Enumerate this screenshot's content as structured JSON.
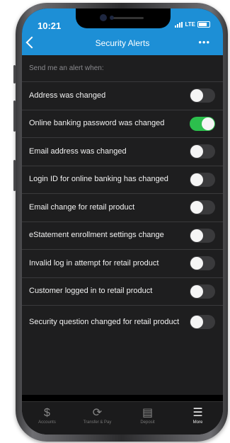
{
  "status": {
    "time": "10:21",
    "network": "LTE"
  },
  "header": {
    "title": "Security Alerts",
    "more": "•••"
  },
  "section_label": "Send me an alert when:",
  "alerts": [
    {
      "label": "Address was changed",
      "enabled": false
    },
    {
      "label": "Online banking password was changed",
      "enabled": true
    },
    {
      "label": "Email address was changed",
      "enabled": false
    },
    {
      "label": "Login ID for online banking has changed",
      "enabled": false
    },
    {
      "label": "Email change for retail product",
      "enabled": false
    },
    {
      "label": "eStatement enrollment settings change",
      "enabled": false
    },
    {
      "label": "Invalid log in attempt for retail product",
      "enabled": false
    },
    {
      "label": "Customer logged in to retail product",
      "enabled": false
    },
    {
      "label": "Security question changed for retail product",
      "enabled": false
    }
  ],
  "tabs": [
    {
      "label": "Accounts",
      "icon": "dollar-icon"
    },
    {
      "label": "Transfer & Pay",
      "icon": "transfer-icon"
    },
    {
      "label": "Deposit",
      "icon": "check-deposit-icon"
    },
    {
      "label": "More",
      "icon": "menu-icon",
      "active": true
    }
  ],
  "colors": {
    "header": "#1d8fd6",
    "toggle_on": "#2cbf4d",
    "background": "#1e1e1f"
  }
}
